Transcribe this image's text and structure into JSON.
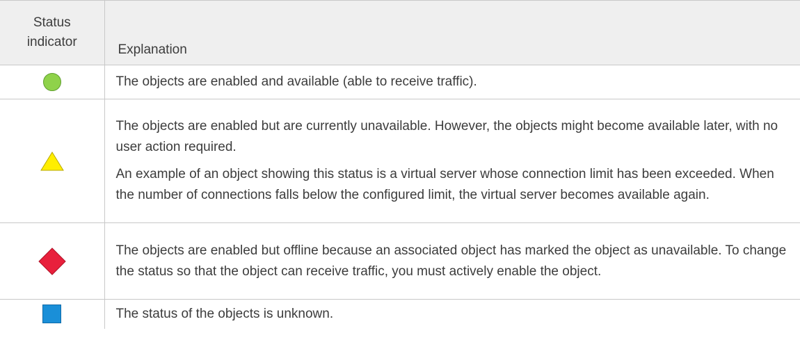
{
  "header": {
    "indicator_line1": "Status",
    "indicator_line2": "indicator",
    "explanation": "Explanation"
  },
  "rows": [
    {
      "icon": "green-circle",
      "color": "#8fd24a",
      "paragraphs": [
        "The objects are enabled and available (able to receive traffic)."
      ]
    },
    {
      "icon": "yellow-triangle",
      "color": "#ffee00",
      "paragraphs": [
        "The objects are enabled but are currently unavailable. However, the objects might become available later, with no user action required.",
        "An example of an object showing this status is a virtual server whose connection limit has been exceeded. When the number of connections falls below the configured limit, the virtual server becomes available again."
      ]
    },
    {
      "icon": "red-diamond",
      "color": "#e8203c",
      "paragraphs": [
        "The objects are enabled but offline because an associated object has marked the object as unavailable. To change the status so that the object can receive traffic, you must actively enable the object."
      ]
    },
    {
      "icon": "blue-square",
      "color": "#1a8fd8",
      "paragraphs": [
        "The status of the objects is unknown."
      ]
    }
  ]
}
